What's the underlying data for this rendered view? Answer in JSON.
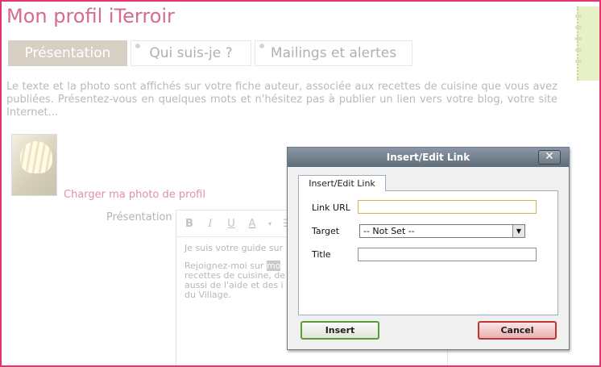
{
  "page": {
    "title": "Mon profil iTerroir",
    "tabs": [
      {
        "label": "Présentation"
      },
      {
        "label": "Qui suis-je ?"
      },
      {
        "label": "Mailings et alertes"
      }
    ],
    "intro_text": "Le texte et la photo sont affichés sur votre fiche auteur, associée aux recettes de cuisine que vous avez publiées. Présentez-vous en quelques mots et n'hésitez pas à publier un lien vers votre blog, votre site Internet...",
    "upload_photo_link": "Charger ma photo de profil",
    "presentation_label": "Présentation"
  },
  "editor": {
    "toolbar": {
      "bold": "B",
      "italic": "I",
      "underline": "U",
      "font_color": "A"
    },
    "paragraph_1": "Je suis votre guide sur",
    "paragraph_2_lines": [
      "Rejoignez-moi sur ",
      "recettes de cuisine, de",
      "aussi de l'aide et des i",
      "du Village."
    ],
    "highlight_text": "mo"
  },
  "dialog": {
    "title": "Insert/Edit Link",
    "close_glyph": "✕",
    "tab_label": "Insert/Edit Link",
    "fields": {
      "link_url_label": "Link URL",
      "link_url_value": "",
      "target_label": "Target",
      "target_value": "-- Not Set --",
      "title_label": "Title",
      "title_value": ""
    },
    "insert_button": "Insert",
    "cancel_button": "Cancel"
  },
  "colors": {
    "frame_border": "#e0356e",
    "title_pink": "#d66a93",
    "active_tab": "#d8cfc4"
  }
}
